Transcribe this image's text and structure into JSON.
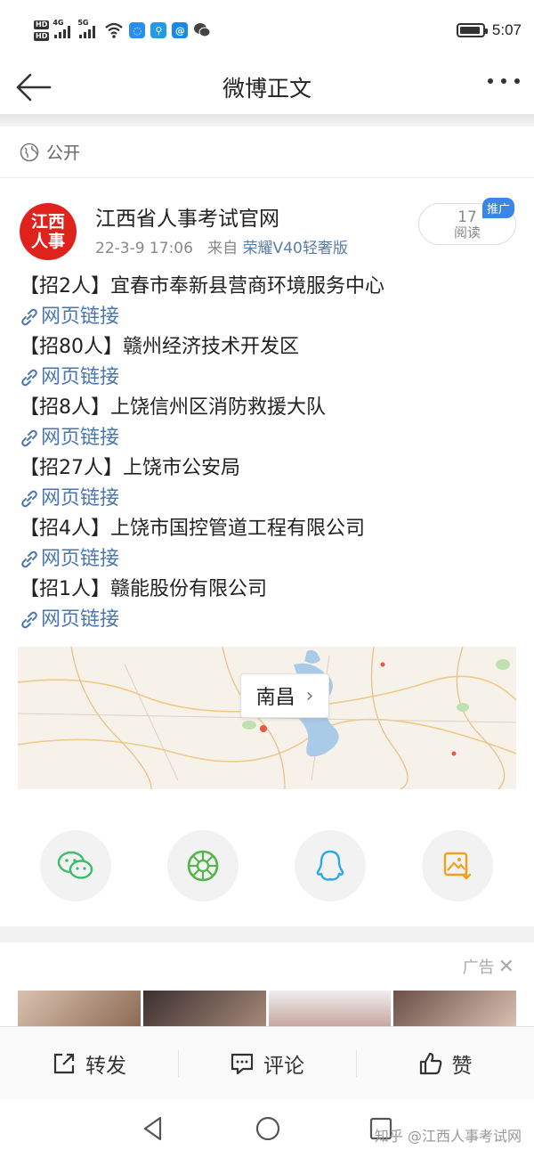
{
  "status_bar": {
    "hd1": "HD",
    "hd2": "HD",
    "net1": "4G",
    "net2": "5G",
    "time": "5:07",
    "battery_level": 0.9
  },
  "nav": {
    "title": "微博正文"
  },
  "visibility": {
    "label": "公开"
  },
  "post": {
    "avatar_text_top": "江西",
    "avatar_text_bottom": "人事",
    "author": "江西省人事考试官网",
    "date": "22-3-9 17:06",
    "source_prefix": "来自",
    "source": "荣耀V40轻奢版",
    "read_count": "17",
    "read_label": "阅读",
    "promo_badge": "推广",
    "items": [
      {
        "text": "【招2人】宜春市奉新县营商环境服务中心",
        "link": "网页链接"
      },
      {
        "text": "【招80人】赣州经济技术开发区",
        "link": "网页链接"
      },
      {
        "text": "【招8人】上饶信州区消防救援大队",
        "link": "网页链接"
      },
      {
        "text": "【招27人】上饶市公安局",
        "link": "网页链接"
      },
      {
        "text": "【招4人】上饶市国控管道工程有限公司",
        "link": "网页链接"
      },
      {
        "text": "【招1人】赣能股份有限公司",
        "link": "网页链接"
      }
    ]
  },
  "map": {
    "location": "南昌"
  },
  "share": [
    "wechat-icon",
    "moments-icon",
    "qq-icon",
    "save-image-icon"
  ],
  "ad": {
    "label": "广告"
  },
  "actions": {
    "repost": "转发",
    "comment": "评论",
    "like": "赞"
  },
  "watermark": "知乎 @江西人事考试网"
}
